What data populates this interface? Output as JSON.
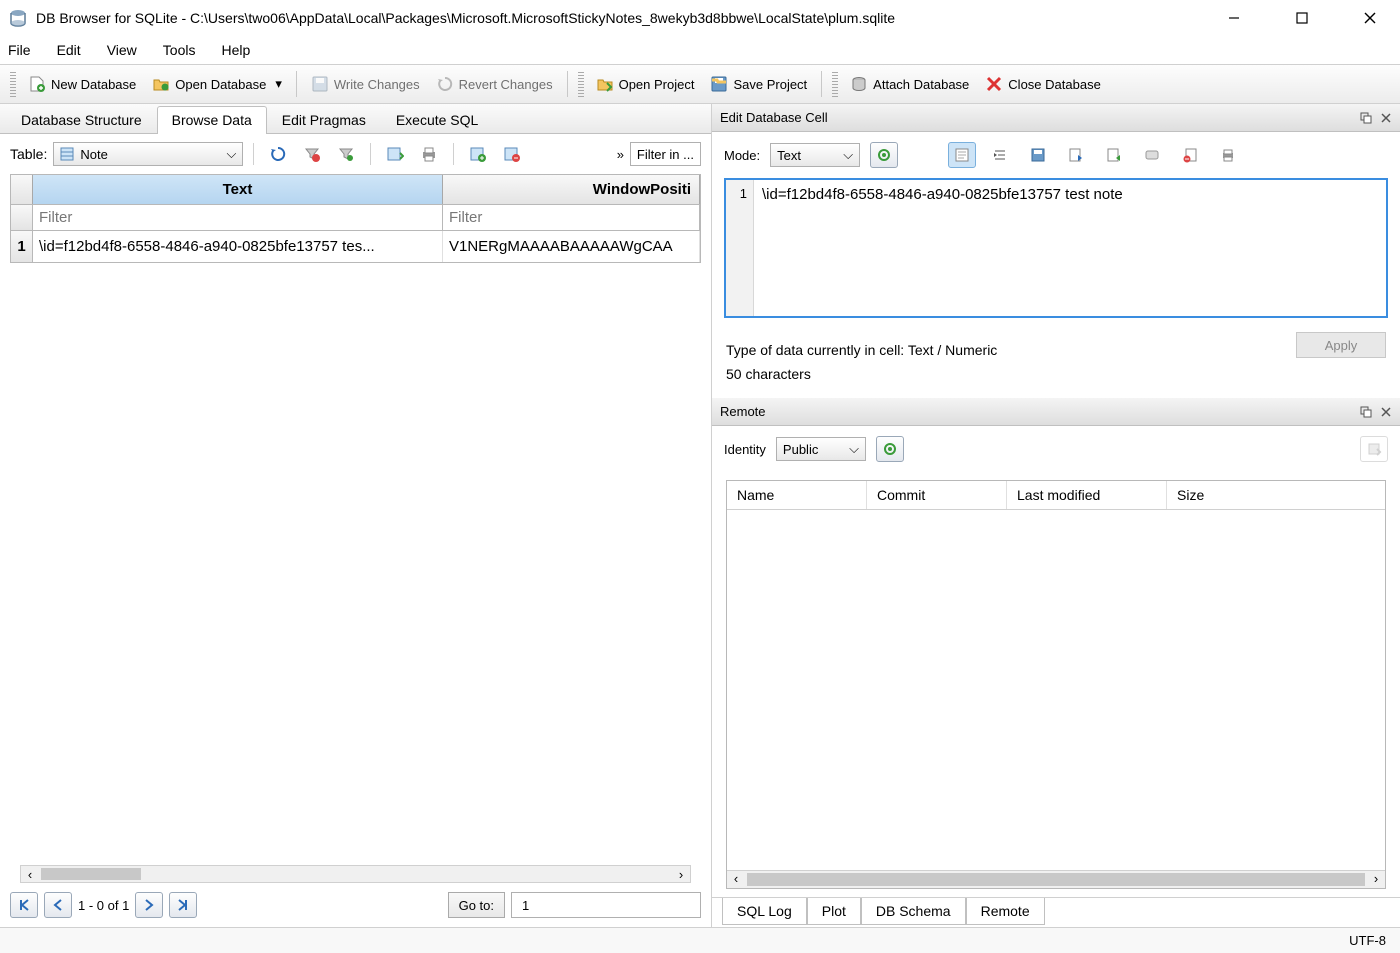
{
  "window": {
    "title": "DB Browser for SQLite - C:\\Users\\two06\\AppData\\Local\\Packages\\Microsoft.MicrosoftStickyNotes_8wekyb3d8bbwe\\LocalState\\plum.sqlite"
  },
  "menu": {
    "file": "File",
    "edit": "Edit",
    "view": "View",
    "tools": "Tools",
    "help": "Help"
  },
  "toolbar": {
    "new_db": "New Database",
    "open_db": "Open Database",
    "write": "Write Changes",
    "revert": "Revert Changes",
    "open_proj": "Open Project",
    "save_proj": "Save Project",
    "attach": "Attach Database",
    "close": "Close Database"
  },
  "tabs": {
    "structure": "Database Structure",
    "browse": "Browse Data",
    "pragmas": "Edit Pragmas",
    "execute": "Execute SQL"
  },
  "browse": {
    "table_label": "Table:",
    "table_selected": "Note",
    "filter_placeholder": "Filter in ...",
    "filter_chevron": "»",
    "columns": [
      "Text",
      "WindowPositi"
    ],
    "col_filter": "Filter",
    "rows": [
      {
        "n": "1",
        "text": "\\id=f12bd4f8-6558-4846-a940-0825bfe13757 tes...",
        "winpos": "V1NERgMAAAABAAAAAWgCAA"
      }
    ],
    "pager": {
      "status": "1 - 0 of 1",
      "goto": "Go to:",
      "goto_val": "1"
    }
  },
  "cell": {
    "title": "Edit Database Cell",
    "mode_label": "Mode:",
    "mode": "Text",
    "line": "1",
    "content": "\\id=f12bd4f8-6558-4846-a940-0825bfe13757 test note",
    "type_info": "Type of data currently in cell: Text / Numeric",
    "char_count": "50 characters",
    "apply": "Apply"
  },
  "remote": {
    "title": "Remote",
    "identity_label": "Identity",
    "identity": "Public",
    "columns": {
      "name": "Name",
      "commit": "Commit",
      "last_mod": "Last modified",
      "size": "Size"
    }
  },
  "bottom_tabs": {
    "sql_log": "SQL Log",
    "plot": "Plot",
    "db_schema": "DB Schema",
    "remote": "Remote"
  },
  "status": {
    "encoding": "UTF-8"
  }
}
